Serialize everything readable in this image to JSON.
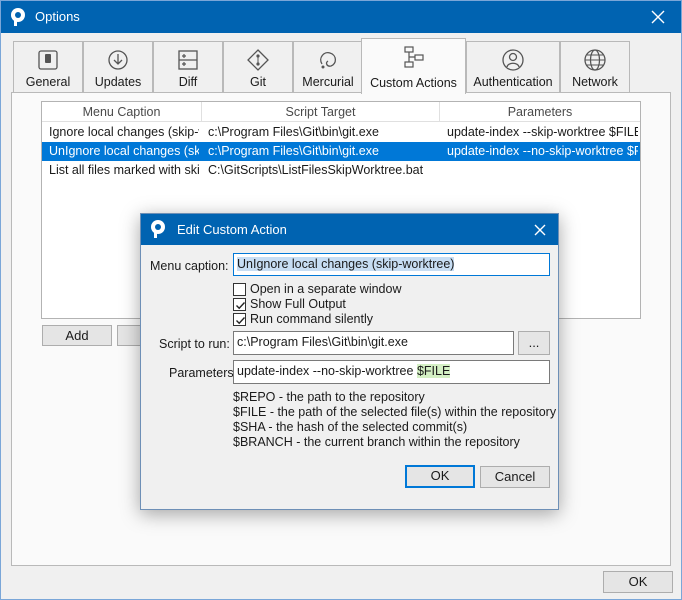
{
  "window": {
    "title": "Options"
  },
  "tabs": [
    {
      "label": "General",
      "icon": "toggle-icon"
    },
    {
      "label": "Updates",
      "icon": "download-icon"
    },
    {
      "label": "Diff",
      "icon": "diff-icon"
    },
    {
      "label": "Git",
      "icon": "git-icon"
    },
    {
      "label": "Mercurial",
      "icon": "mercurial-icon"
    },
    {
      "label": "Custom Actions",
      "icon": "flowchart-icon"
    },
    {
      "label": "Authentication",
      "icon": "user-icon"
    },
    {
      "label": "Network",
      "icon": "globe-icon"
    }
  ],
  "active_tab": "Custom Actions",
  "list": {
    "columns": [
      "Menu Caption",
      "Script Target",
      "Parameters"
    ],
    "rows": [
      {
        "caption": "Ignore local changes (skip-worktree)",
        "target": "c:\\Program Files\\Git\\bin\\git.exe",
        "params": "update-index --skip-worktree  $FILE"
      },
      {
        "caption": "UnIgnore local changes (skip-worktree)",
        "target": "c:\\Program Files\\Git\\bin\\git.exe",
        "params": "update-index --no-skip-worktree $FILE"
      },
      {
        "caption": "List all files marked with skip-worktree",
        "target": "C:\\GitScripts\\ListFilesSkipWorktree.bat",
        "params": ""
      }
    ]
  },
  "buttons": {
    "add": "Add",
    "ok": "OK"
  },
  "dialog": {
    "title": "Edit Custom Action",
    "menu_caption_label": "Menu caption:",
    "menu_caption_value": "UnIgnore local changes (skip-worktree)",
    "checkboxes": [
      {
        "label": "Open in a separate window",
        "checked": false
      },
      {
        "label": "Show Full Output",
        "checked": true
      },
      {
        "label": "Run command silently",
        "checked": true
      }
    ],
    "script_label": "Script to run:",
    "script_value": "c:\\Program Files\\Git\\bin\\git.exe",
    "browse_label": "...",
    "params_label": "Parameters",
    "params_value_prefix": "update-index --no-skip-worktree ",
    "params_value_token": "$FILE",
    "hints": [
      "$REPO - the path to the repository",
      "$FILE - the path of the selected file(s) within the repository",
      "$SHA - the hash of the selected commit(s)",
      "$BRANCH - the current branch within the repository"
    ],
    "ok_label": "OK",
    "cancel_label": "Cancel"
  }
}
